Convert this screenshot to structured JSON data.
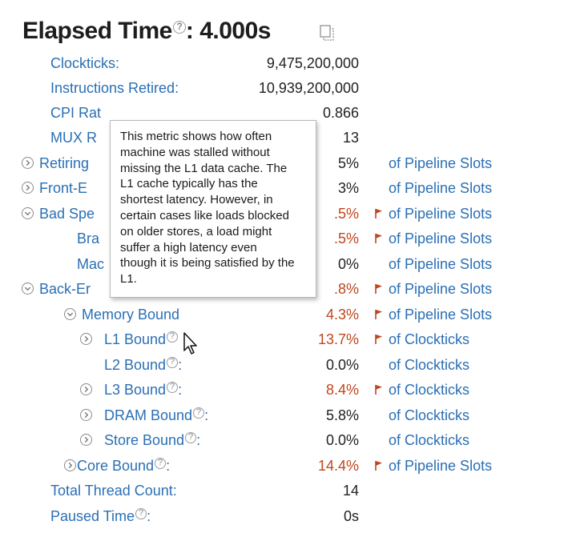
{
  "title": {
    "text": "Elapsed Time",
    "colon_value": ": 4.000s",
    "help": "?"
  },
  "colors": {
    "link": "#2a6fb5",
    "warn": "#c0461d",
    "text": "#222222"
  },
  "rows": [
    {
      "label": "Clockticks:",
      "value": "9,475,200,000",
      "unit": ""
    },
    {
      "label": "Instructions Retired:",
      "value": "10,939,200,000",
      "unit": ""
    },
    {
      "label": "CPI Rat",
      "value": "0.866",
      "unit": ""
    },
    {
      "label": "MUX R",
      "value": "13",
      "unit": ""
    },
    {
      "label": "Retiring",
      "value": "5%",
      "unit": "of Pipeline Slots"
    },
    {
      "label": "Front-E",
      "value": "3%",
      "unit": "of Pipeline Slots"
    },
    {
      "label": "Bad Spe",
      "value": ".5%",
      "unit": "of Pipeline Slots"
    },
    {
      "label": "Bra",
      "value": ".5%",
      "unit": "of Pipeline Slots"
    },
    {
      "label": "Mac",
      "value": "0%",
      "unit": "of Pipeline Slots"
    },
    {
      "label": "Back-Er",
      "value": ".8%",
      "unit": "of Pipeline Slots"
    },
    {
      "label": "Memory Bound",
      "value": "4.3%",
      "unit": "of Pipeline Slots"
    },
    {
      "label": "L1 Bound",
      "value": "13.7%",
      "unit": "of Clockticks"
    },
    {
      "label": "L2 Bound",
      "value": "0.0%",
      "unit": "of Clockticks"
    },
    {
      "label": "L3 Bound",
      "value": "8.4%",
      "unit": "of Clockticks"
    },
    {
      "label": "DRAM Bound",
      "value": "5.8%",
      "unit": "of Clockticks"
    },
    {
      "label": "Store Bound",
      "value": "0.0%",
      "unit": "of Clockticks"
    },
    {
      "label": "Core Bound",
      "value": "14.4%",
      "unit": "of Pipeline Slots"
    },
    {
      "label": "Total Thread Count:",
      "value": "14",
      "unit": ""
    },
    {
      "label": "Paused Time",
      "value": "0s",
      "unit": ""
    }
  ],
  "tooltip": {
    "lines": [
      "This metric shows how often",
      "machine was stalled without",
      "missing the L1 data cache. The",
      "L1 cache typically has the",
      "shortest latency. However, in",
      "certain cases like loads blocked",
      "on older stores, a load might",
      "suffer a high latency even",
      "though it is being satisfied by the",
      "L1."
    ]
  }
}
